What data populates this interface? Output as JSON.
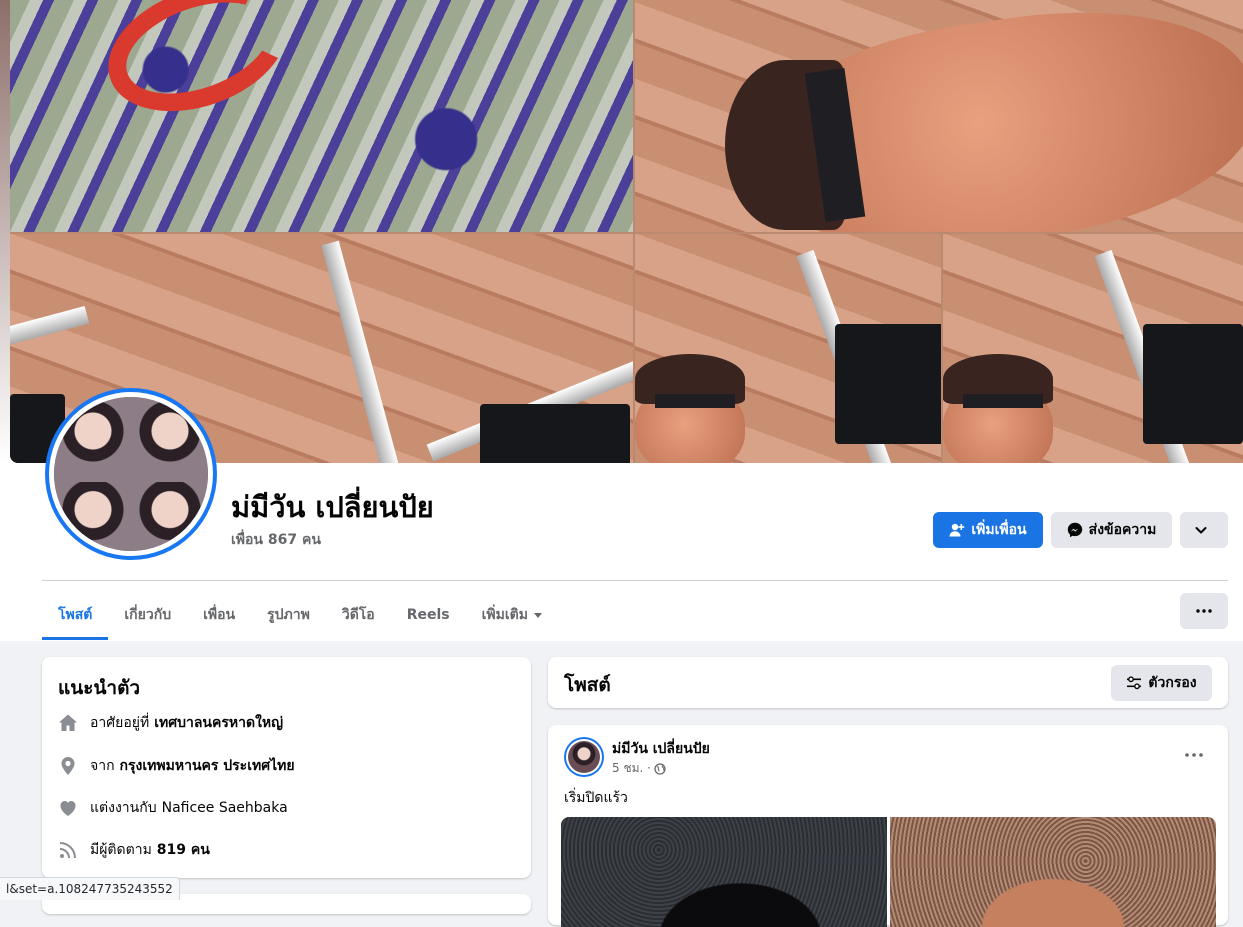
{
  "profile": {
    "name": "ม่มีวัน เปลี่ยนปัย",
    "friends_count": "เพื่อน 867 คน"
  },
  "actions": {
    "add_friend": "เพิ่มเพื่อน",
    "message": "ส่งข้อความ"
  },
  "tabs": [
    {
      "label": "โพสต์",
      "active": true
    },
    {
      "label": "เกี่ยวกับ"
    },
    {
      "label": "เพื่อน"
    },
    {
      "label": "รูปภาพ"
    },
    {
      "label": "วิดีโอ"
    },
    {
      "label": "Reels"
    },
    {
      "label": "เพิ่มเติม"
    }
  ],
  "intro": {
    "title": "แนะนำตัว",
    "lives_prefix": "อาศัยอยู่ที่",
    "lives_value": "เทศบาลนครหาดใหญ่",
    "from_prefix": "จาก",
    "from_value": "กรุงเทพมหานคร ประเทศไทย",
    "married_prefix": "แต่งงานกับ",
    "married_value": "Naficee Saehbaka",
    "followers_prefix": "มีผู้ติดตาม",
    "followers_value": "819 คน"
  },
  "posts": {
    "title": "โพสต์",
    "filter_label": "ตัวกรอง",
    "items": [
      {
        "author": "ม่มีวัน เปลี่ยนปัย",
        "time": "5 ชม. ·",
        "text": "เริ่มปิดแร้ว"
      }
    ]
  },
  "status_bar": {
    "url": "l&set=a.108247735243552"
  },
  "colors": {
    "accent": "#1b74e4",
    "page_bg": "#f0f2f5",
    "secondary_button": "#e4e6eb",
    "muted_text": "#65676b"
  }
}
